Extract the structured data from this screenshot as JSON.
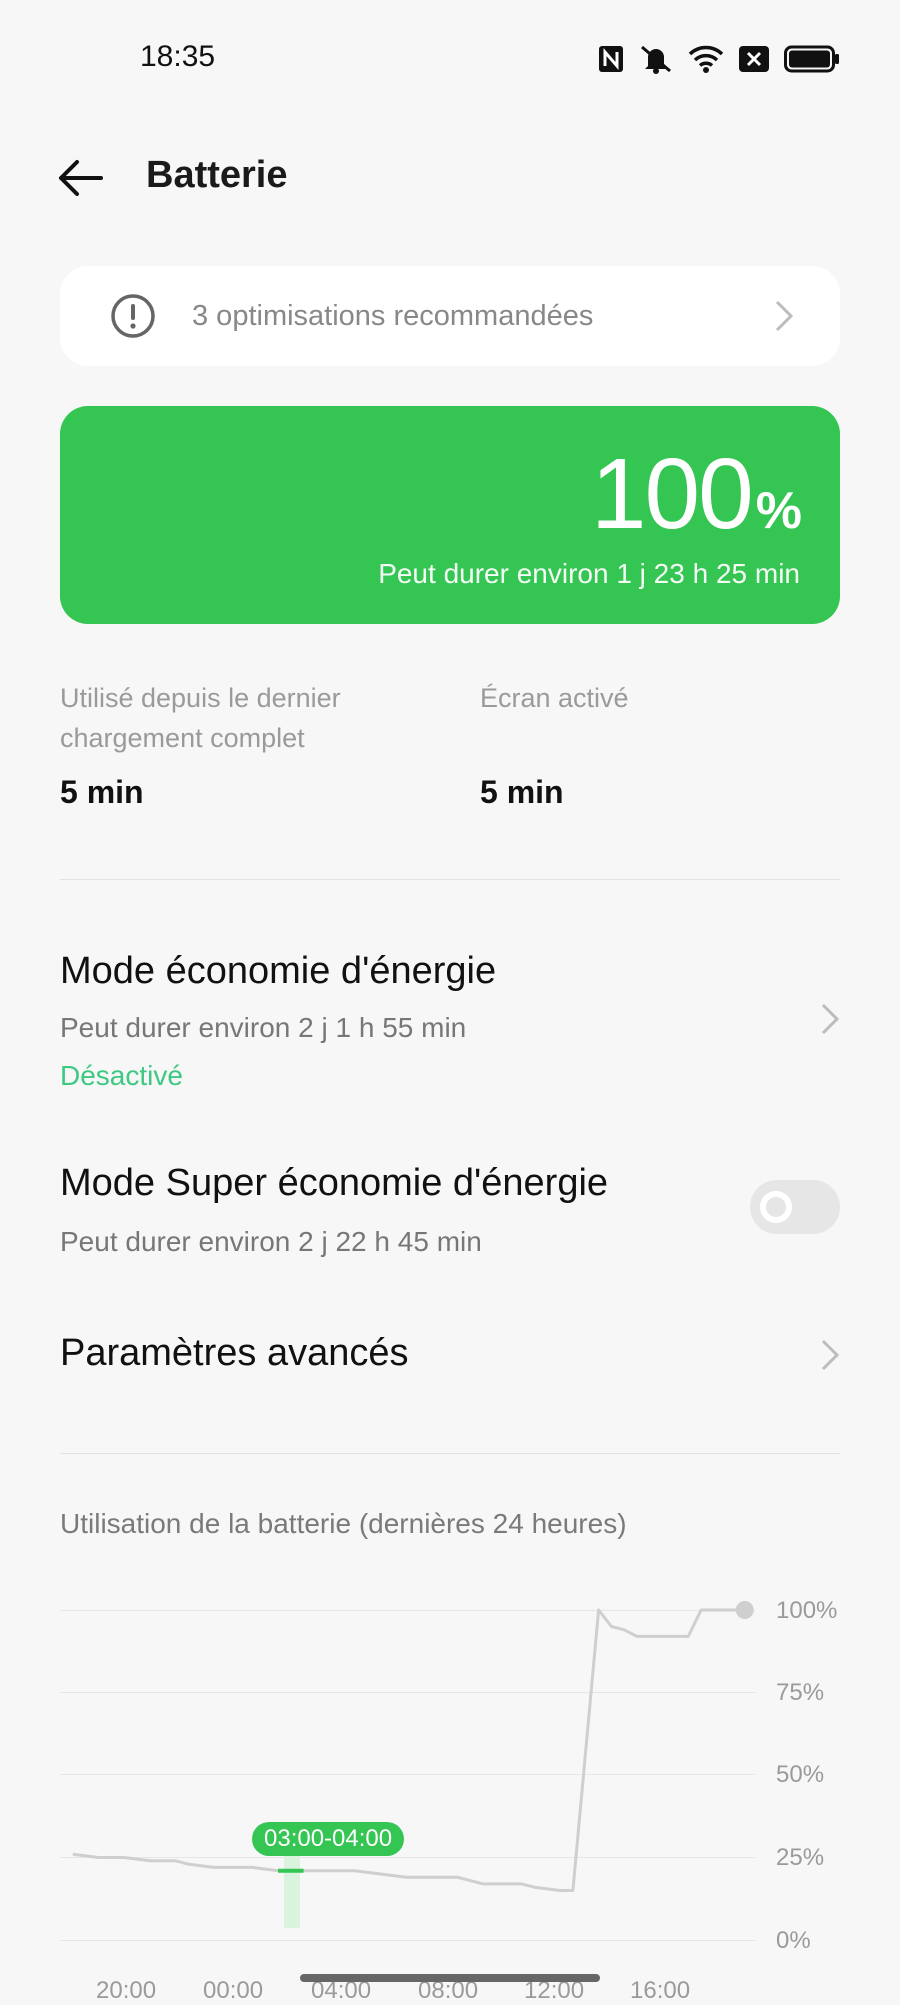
{
  "status_bar": {
    "time": "18:35",
    "icons": [
      "nfc-icon",
      "mute-icon",
      "wifi-icon",
      "notification-icon",
      "battery-icon"
    ]
  },
  "header": {
    "title": "Batterie"
  },
  "optimizations": {
    "text": "3 optimisations recommandées"
  },
  "battery": {
    "level": "100",
    "unit": "%",
    "remaining": "Peut durer environ 1 j 23 h 25 min",
    "card_color": "#34c552",
    "level_value": 100
  },
  "usage": {
    "since_charge_label": "Utilisé depuis le dernier chargement complet",
    "since_charge_line1": "Utilisé depuis le dernier",
    "since_charge_line2": "chargement complet",
    "since_charge_value": "5 min",
    "screen_label": "Écran activé",
    "screen_value": "5 min"
  },
  "power_saving": {
    "title": "Mode économie d'énergie",
    "subtitle": "Peut durer environ 2 j 1 h 55 min",
    "status": "Désactivé",
    "status_color": "#3ec983"
  },
  "super_power_saving": {
    "title": "Mode Super économie d'énergie",
    "subtitle": "Peut durer environ 2 j 22 h 45 min",
    "enabled": false
  },
  "advanced": {
    "title": "Paramètres avancés"
  },
  "chart_data": {
    "type": "line",
    "title": "Utilisation de la batterie (dernières 24 heures)",
    "x_ticks": [
      "20:00",
      "00:00",
      "04:00",
      "08:00",
      "12:00",
      "16:00"
    ],
    "y_ticks": [
      "100%",
      "75%",
      "50%",
      "25%",
      "0%"
    ],
    "ylim": [
      0,
      100
    ],
    "xlim": [
      18.5,
      41
    ],
    "series": [
      {
        "points": [
          [
            19.0,
            26
          ],
          [
            20.0,
            25
          ],
          [
            21.0,
            25
          ],
          [
            22.0,
            24
          ],
          [
            23.0,
            24
          ],
          [
            23.5,
            23
          ],
          [
            24.5,
            22
          ],
          [
            26.0,
            22
          ],
          [
            27.0,
            21
          ],
          [
            28.0,
            21
          ],
          [
            30.0,
            21
          ],
          [
            31.0,
            20
          ],
          [
            32.0,
            19
          ],
          [
            34.0,
            19
          ],
          [
            35.0,
            17
          ],
          [
            36.5,
            17
          ],
          [
            37.0,
            16
          ],
          [
            38.0,
            15
          ],
          [
            38.5,
            15
          ],
          [
            39.5,
            100
          ],
          [
            40.0,
            95
          ],
          [
            40.5,
            94
          ],
          [
            41.0,
            92
          ],
          [
            42.0,
            92
          ],
          [
            43.0,
            92
          ],
          [
            43.5,
            100
          ],
          [
            44.5,
            100
          ],
          [
            45.2,
            100
          ]
        ]
      }
    ],
    "highlight": {
      "label": "03:00-04:00",
      "from": 27,
      "to": 28
    },
    "line_color": "#cfcfcf",
    "highlight_color": "#34c552"
  }
}
